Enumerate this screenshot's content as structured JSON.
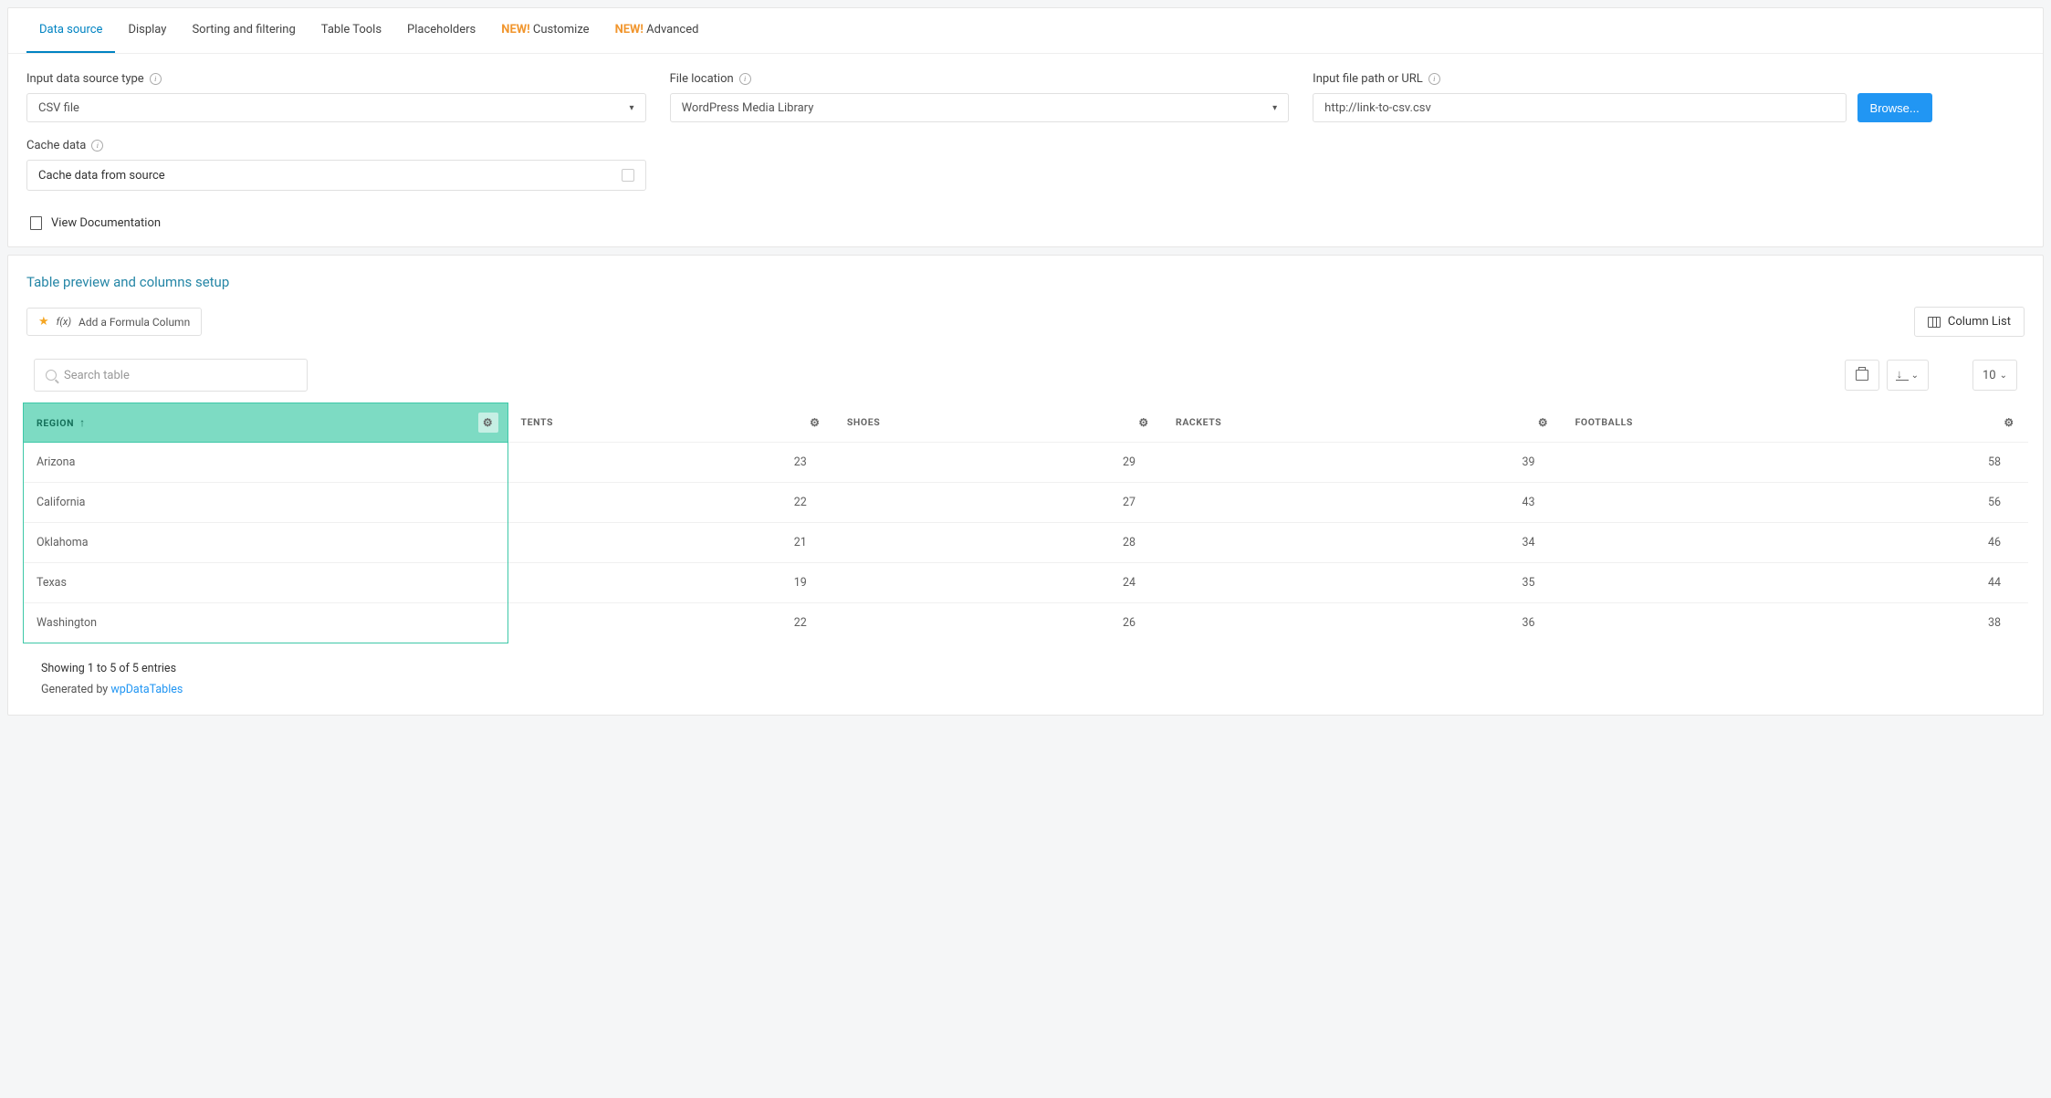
{
  "tabs": [
    {
      "label": "Data source",
      "active": true,
      "new": false
    },
    {
      "label": "Display",
      "active": false,
      "new": false
    },
    {
      "label": "Sorting and filtering",
      "active": false,
      "new": false
    },
    {
      "label": "Table Tools",
      "active": false,
      "new": false
    },
    {
      "label": "Placeholders",
      "active": false,
      "new": false
    },
    {
      "label": "Customize",
      "active": false,
      "new": true
    },
    {
      "label": "Advanced",
      "active": false,
      "new": true
    }
  ],
  "new_badge": "NEW!",
  "form": {
    "source_type": {
      "label": "Input data source type",
      "value": "CSV file"
    },
    "file_location": {
      "label": "File location",
      "value": "WordPress Media Library"
    },
    "file_path": {
      "label": "Input file path or URL",
      "value": "http://link-to-csv.csv",
      "browse": "Browse..."
    },
    "cache": {
      "label": "Cache data",
      "option": "Cache data from source"
    }
  },
  "doc_link": "View Documentation",
  "preview_title": "Table preview and columns setup",
  "formula_btn": "Add a Formula Column",
  "column_list_btn": "Column List",
  "search_placeholder": "Search table",
  "page_size": "10",
  "columns": [
    "REGION",
    "TENTS",
    "SHOES",
    "RACKETS",
    "FOOTBALLS"
  ],
  "rows": [
    {
      "region": "Arizona",
      "tents": "23",
      "shoes": "29",
      "rackets": "39",
      "footballs": "58"
    },
    {
      "region": "California",
      "tents": "22",
      "shoes": "27",
      "rackets": "43",
      "footballs": "56"
    },
    {
      "region": "Oklahoma",
      "tents": "21",
      "shoes": "28",
      "rackets": "34",
      "footballs": "46"
    },
    {
      "region": "Texas",
      "tents": "19",
      "shoes": "24",
      "rackets": "35",
      "footballs": "44"
    },
    {
      "region": "Washington",
      "tents": "22",
      "shoes": "26",
      "rackets": "36",
      "footballs": "38"
    }
  ],
  "footer": {
    "showing": "Showing 1 to 5 of 5 entries",
    "generated_prefix": "Generated by ",
    "generated_link": "wpDataTables"
  }
}
